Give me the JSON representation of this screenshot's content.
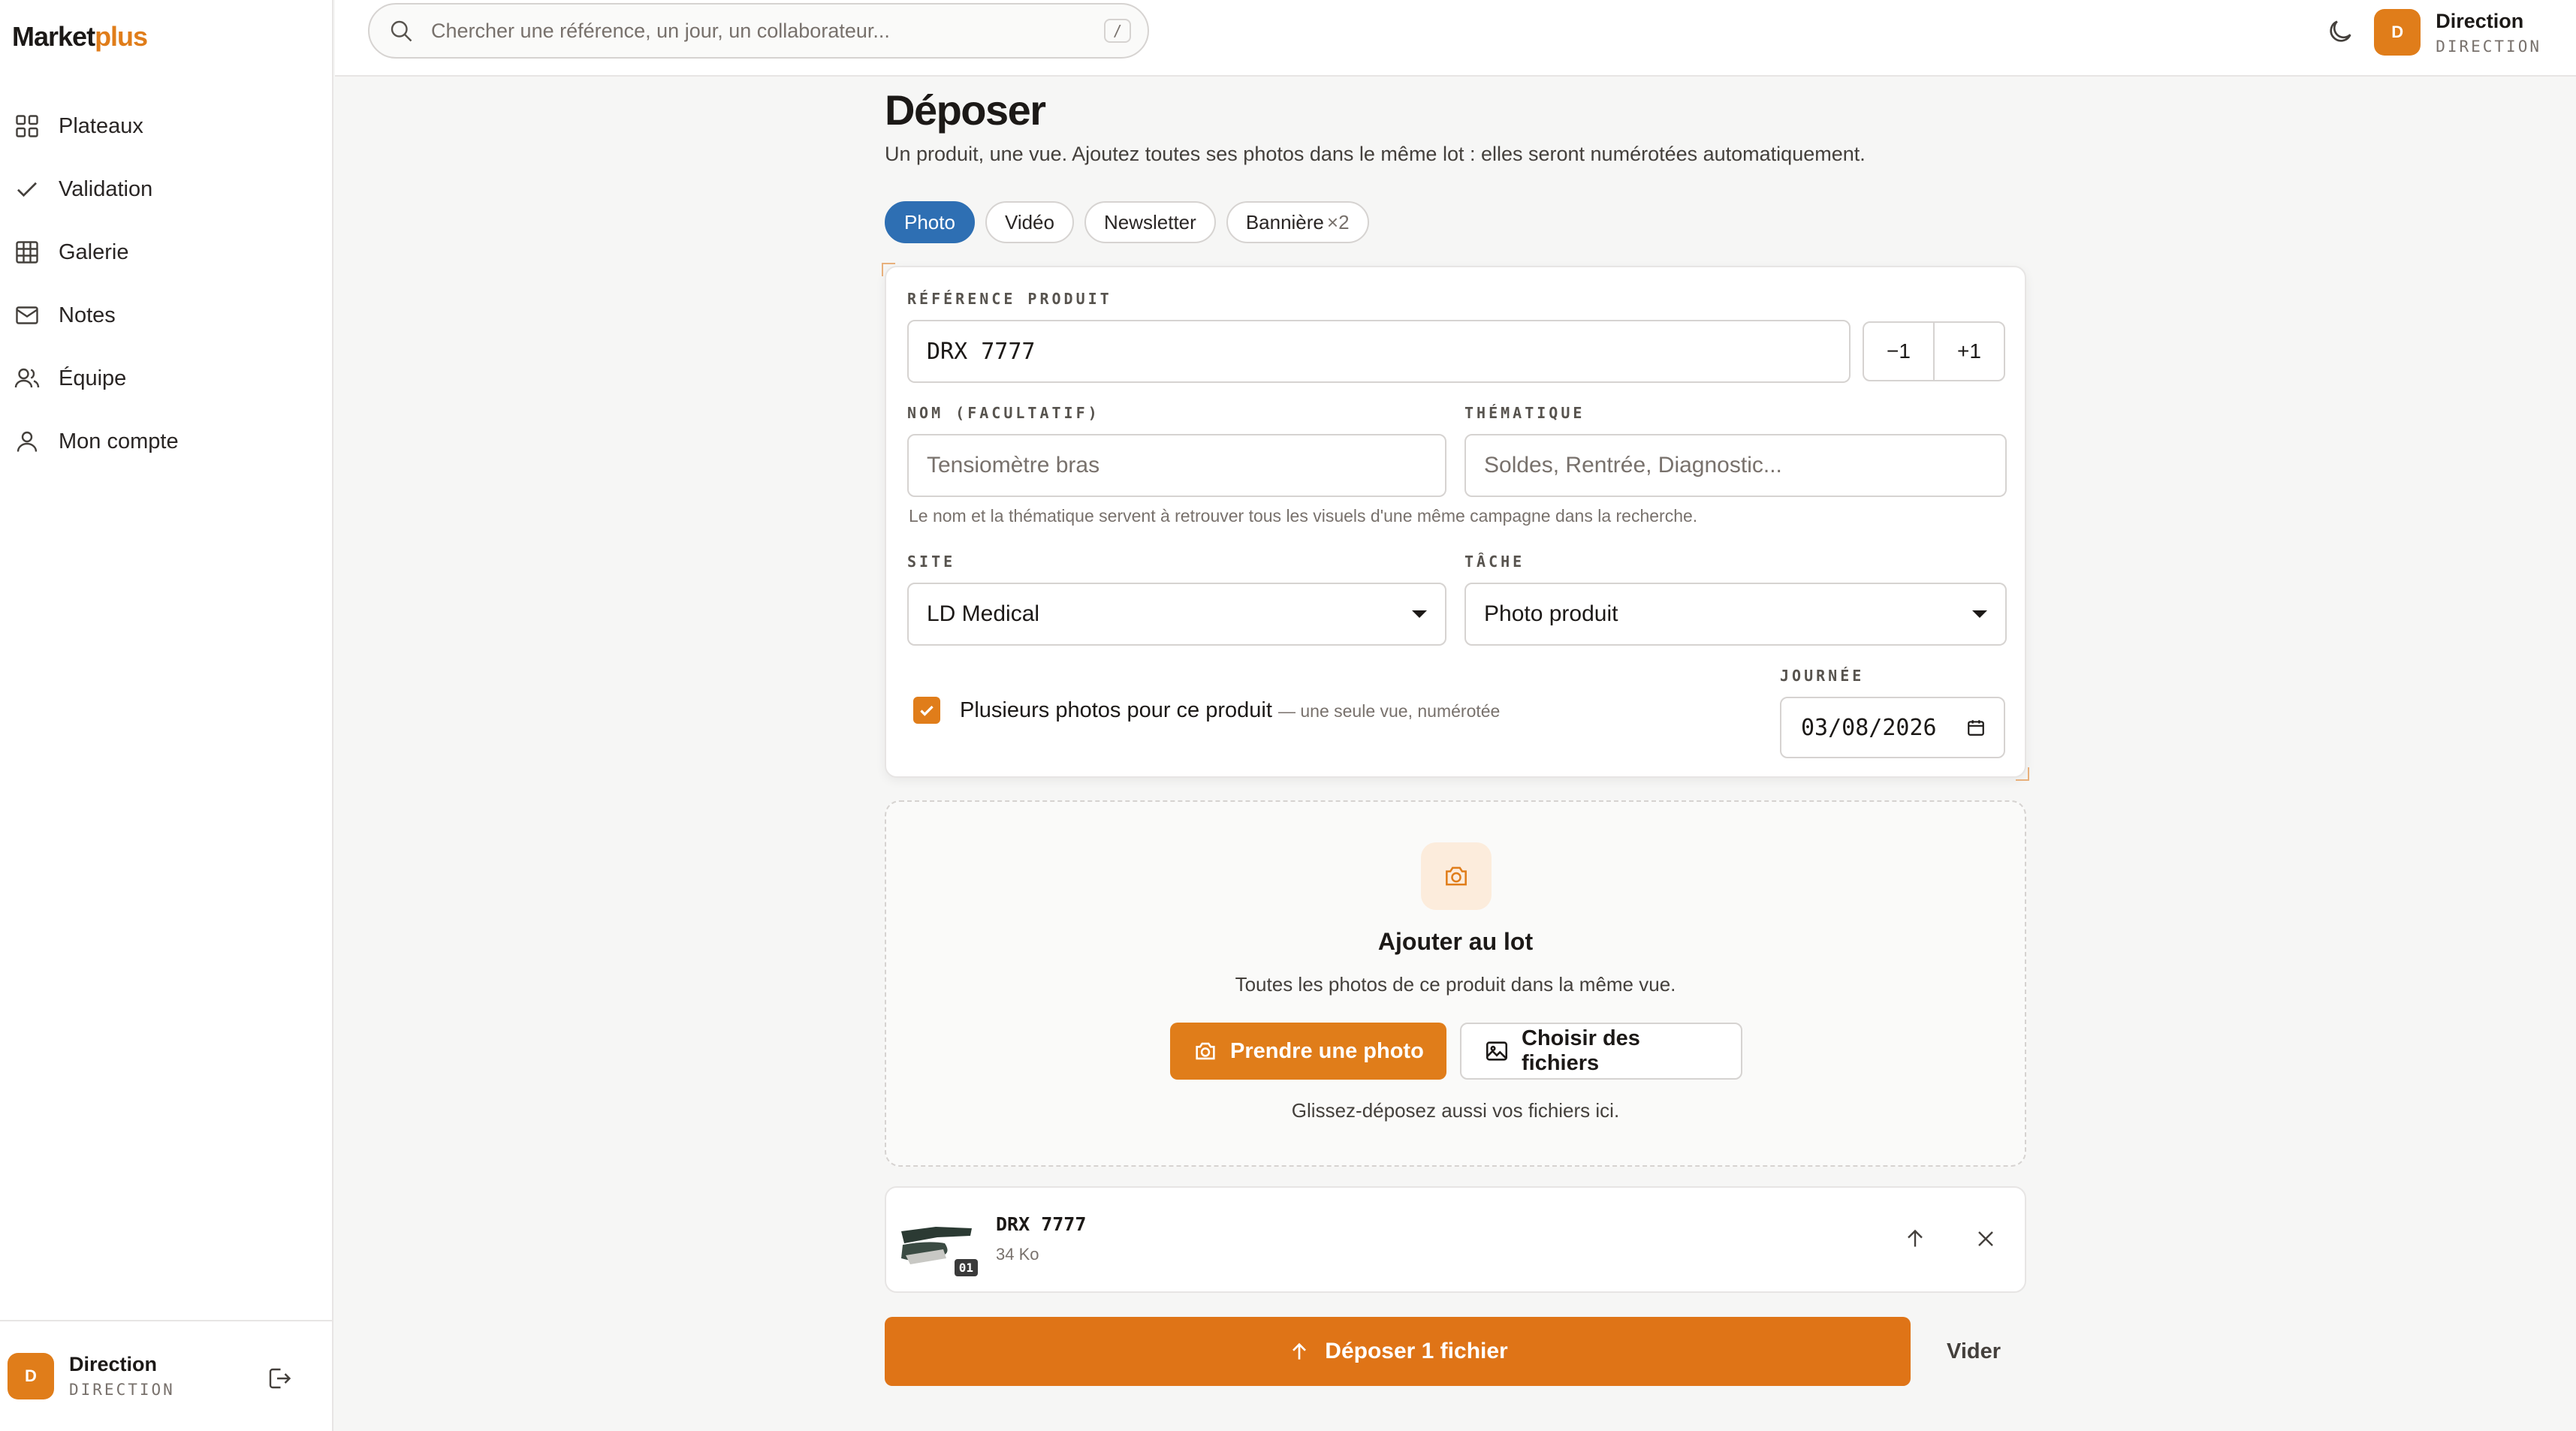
{
  "app": {
    "brand_main": "Market",
    "brand_accent": "plus",
    "accent_color": "#e07d1a",
    "primary_color": "#2e6fb3"
  },
  "sidebar": {
    "items": [
      {
        "label": "Plateaux",
        "icon": "grid-icon"
      },
      {
        "label": "Validation",
        "icon": "check-icon"
      },
      {
        "label": "Galerie",
        "icon": "table-icon"
      },
      {
        "label": "Notes",
        "icon": "mail-icon"
      },
      {
        "label": "Équipe",
        "icon": "users-icon"
      },
      {
        "label": "Mon compte",
        "icon": "user-icon"
      }
    ],
    "user": {
      "initial": "D",
      "name": "Direction",
      "role": "DIRECTION"
    }
  },
  "topbar": {
    "search_placeholder": "Chercher une référence, un jour, un collaborateur...",
    "shortcut": "/",
    "user": {
      "initial": "D",
      "name": "Direction",
      "role": "DIRECTION"
    }
  },
  "page": {
    "title": "Déposer",
    "subtitle": "Un produit, une vue. Ajoutez toutes ses photos dans le même lot : elles seront numérotées automatiquement.",
    "tabs": [
      {
        "label": "Photo",
        "active": true
      },
      {
        "label": "Vidéo"
      },
      {
        "label": "Newsletter"
      },
      {
        "label": "Bannière",
        "suffix": "×2"
      }
    ]
  },
  "form": {
    "ref_label": "RÉFÉRENCE PRODUIT",
    "ref_value": "DRX 7777",
    "minus_label": "−1",
    "plus_label": "+1",
    "name_label": "NOM (FACULTATIF)",
    "name_placeholder": "Tensiomètre bras",
    "theme_label": "THÉMATIQUE",
    "theme_placeholder": "Soldes, Rentrée, Diagnostic...",
    "hint": "Le nom et la thématique servent à retrouver tous les visuels d'une même campagne dans la recherche.",
    "site_label": "SITE",
    "site_value": "LD Medical",
    "task_label": "TÂCHE",
    "task_value": "Photo produit",
    "multi_label": "Plusieurs photos pour ce produit",
    "multi_sub": "— une seule vue, numérotée",
    "multi_checked": true,
    "day_label": "JOURNÉE",
    "day_value": "03/08/2026"
  },
  "dropzone": {
    "title": "Ajouter au lot",
    "subtitle": "Toutes les photos de ce produit dans la même vue.",
    "take_photo": "Prendre une photo",
    "choose_files": "Choisir des fichiers",
    "footer": "Glissez-déposez aussi vos fichiers ici."
  },
  "files": [
    {
      "name": "DRX 7777",
      "size": "34 Ko",
      "index": "01"
    }
  ],
  "actions": {
    "submit": "Déposer 1 fichier",
    "clear": "Vider"
  }
}
